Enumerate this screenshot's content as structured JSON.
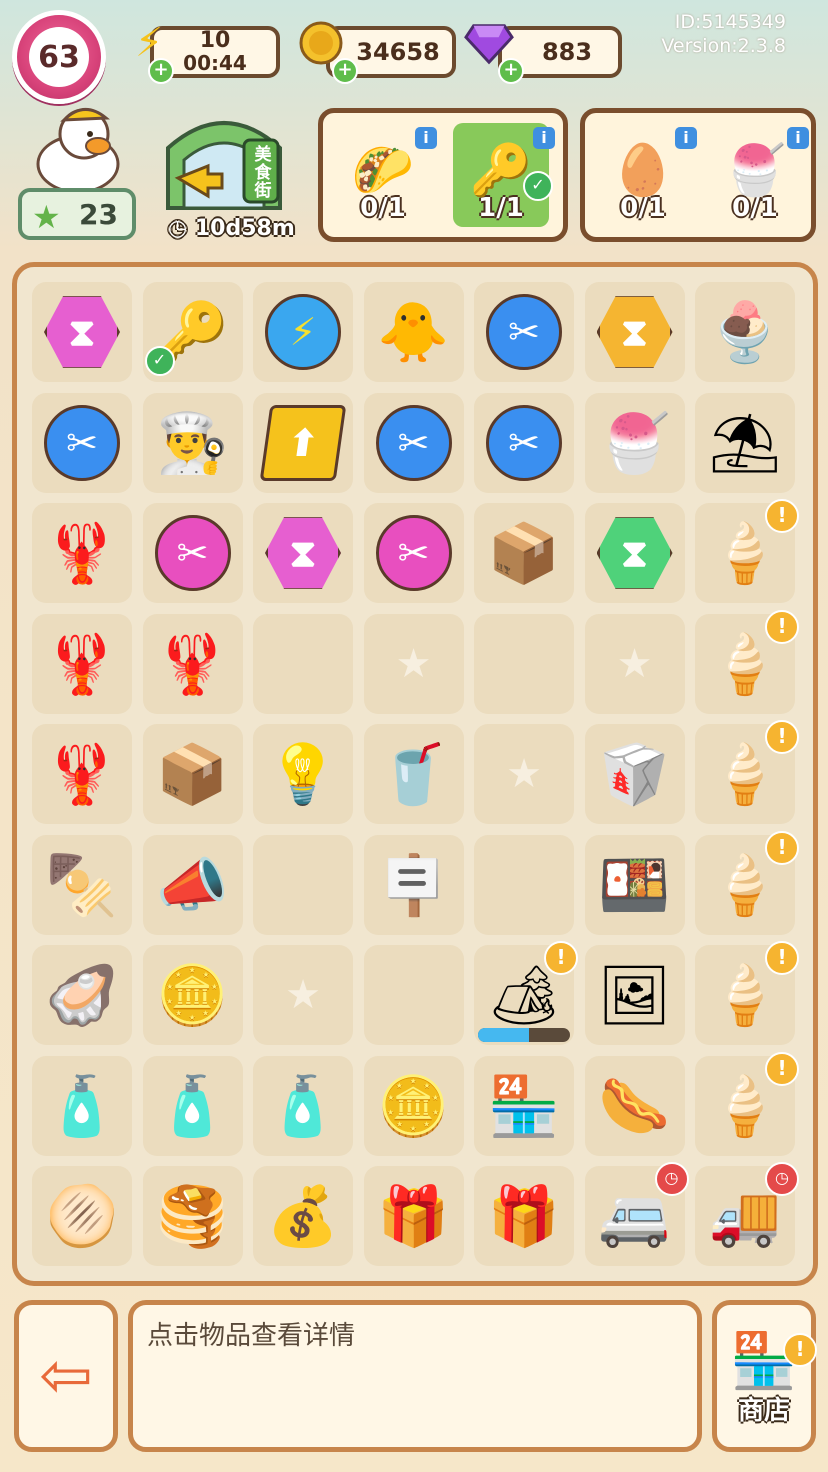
{
  "hud": {
    "level": "63",
    "energy": {
      "icon": "lightning-icon",
      "value": "10",
      "timer": "00:44"
    },
    "coins": {
      "icon": "coin-icon",
      "value": "34658"
    },
    "gems": {
      "icon": "purple-gem-icon",
      "value": "883"
    },
    "player_id": "ID:5145349",
    "version": "Version:2.3.8"
  },
  "profile": {
    "stars": "23"
  },
  "event": {
    "sign": "美食街",
    "timer": "10d58m"
  },
  "orders": [
    {
      "panel": 1,
      "slots": [
        {
          "icon": "taco-icon",
          "glyph": "🌮",
          "count": "0/1",
          "done": false
        },
        {
          "icon": "keychain-icon",
          "glyph": "🔑",
          "count": "1/1",
          "done": true
        }
      ]
    },
    {
      "panel": 2,
      "slots": [
        {
          "icon": "eggs-icon",
          "glyph": "🥚",
          "count": "0/1",
          "done": false
        },
        {
          "icon": "sundae-drink-icon",
          "glyph": "🍧",
          "count": "0/1",
          "done": false
        }
      ]
    }
  ],
  "board": {
    "rows": [
      [
        "pink-hourglass-hex",
        "keychain-check",
        "blue-energy-orb",
        "duck-chef-sparkle",
        "blue-scissors-orb",
        "orange-hourglass-hex",
        "green-ice-cream-cup"
      ],
      [
        "blue-scissors-orb",
        "chef-hat",
        "upgrade-card",
        "blue-scissors-orb",
        "blue-scissors-orb",
        "shaved-ice",
        "umbrella-cart"
      ],
      [
        "crayfish-plate",
        "pink-scissors-orb",
        "pink-hourglass-hex",
        "pink-scissors-orb",
        "cardboard-box",
        "green-hourglass-hex",
        "ice-cream-cart-alert"
      ],
      [
        "crayfish-plate",
        "crayfish-plate",
        "empty",
        "locked",
        "empty",
        "locked",
        "ice-cream-cart-alert"
      ],
      [
        "crayfish-plate",
        "box-stack",
        "string-lights",
        "rainbow-drink",
        "locked",
        "takeout-box-empty",
        "ice-cream-cart-alert"
      ],
      [
        "skewers-plate",
        "megaphone",
        "empty",
        "open-sign",
        "empty",
        "takeout-box-food",
        "ice-cream-cart-alert"
      ],
      [
        "oyster-plate",
        "coin-stack",
        "locked",
        "empty",
        "food-stall-alert",
        "duck-poster",
        "ice-cream-cart-alert"
      ],
      [
        "gas-canister",
        "gas-canister",
        "gas-canister",
        "coin-pair",
        "crayfish-stall",
        "hotdog",
        "ice-cream-cart-alert"
      ],
      [
        "flatbread",
        "flatbread-stack",
        "coin-pile",
        "red-energy-box",
        "red-energy-box",
        "food-truck-timer",
        "delivery-truck-timer"
      ]
    ],
    "stall_progress": 0.55
  },
  "bottom": {
    "hint": "点击物品查看详情",
    "shop_label": "商店"
  },
  "colors": {
    "accent": "#c7854b",
    "pink_level": "#d8437a",
    "done_green": "#88c95a"
  }
}
